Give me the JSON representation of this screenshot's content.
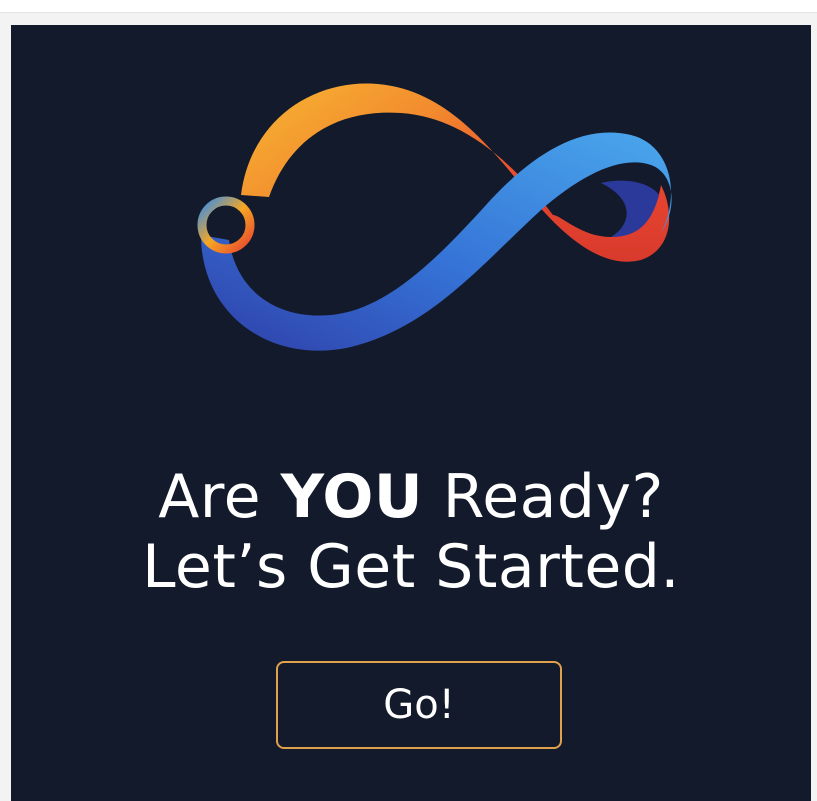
{
  "headline": {
    "line1_prefix": "Are ",
    "line1_emphasis": "YOU",
    "line1_suffix": " Ready?",
    "line2": "Let’s Get Started."
  },
  "cta": {
    "label": "Go!"
  },
  "colors": {
    "card_background": "#131a2b",
    "page_background": "#f3f3f4",
    "button_border": "#e0a14c",
    "text": "#ffffff",
    "logo_orange": "#f5a623",
    "logo_red": "#e8452f",
    "logo_blue": "#3a8ee6",
    "logo_dark_blue": "#2b3a9a"
  },
  "icons": {
    "logo": "infinity-loop-icon"
  }
}
